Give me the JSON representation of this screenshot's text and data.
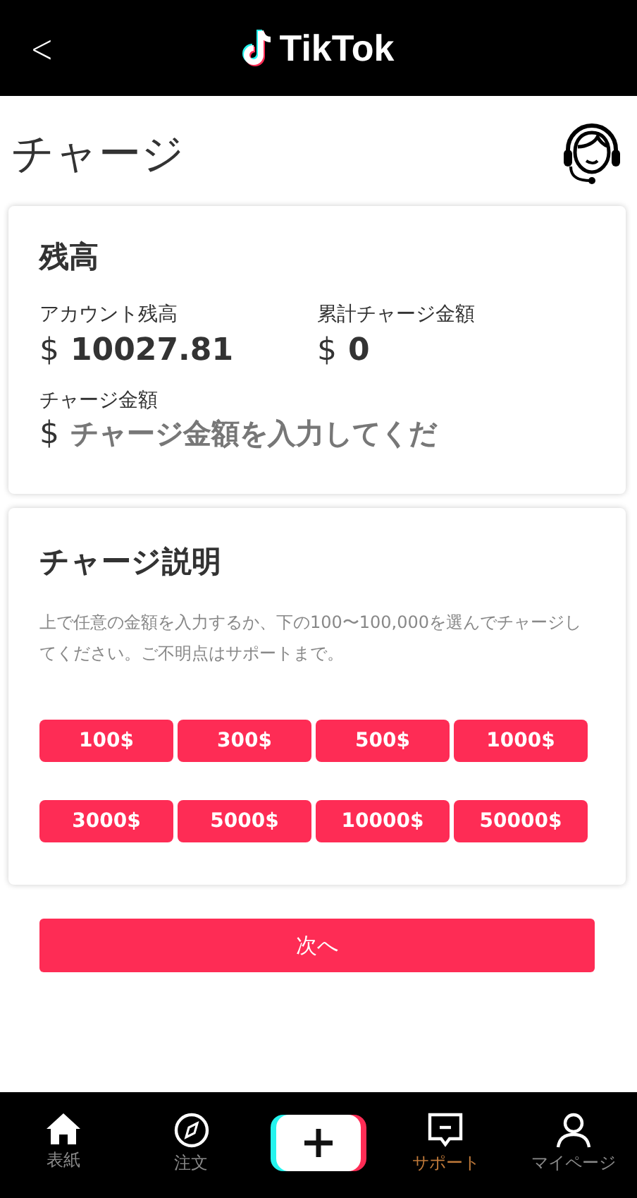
{
  "header": {
    "back": "<",
    "logo_text": "TikTok"
  },
  "page_title": "チャージ",
  "balance_card": {
    "title": "残高",
    "stats": [
      {
        "label": "アカウント残高",
        "currency": "$",
        "value": "10027.81"
      },
      {
        "label": "累計チャージ金額",
        "currency": "$",
        "value": "0"
      }
    ],
    "amount_label": "チャージ金額",
    "amount_currency": "$",
    "amount_placeholder": "チャージ金額を入力してくだ"
  },
  "info_card": {
    "title": "チャージ説明",
    "description": "上で任意の金額を入力するか、下の100〜100,000を選んでチャージしてください。ご不明点はサポートまで。",
    "amounts": [
      "100$",
      "300$",
      "500$",
      "1000$",
      "3000$",
      "5000$",
      "10000$",
      "50000$"
    ]
  },
  "next_button": "次へ",
  "nav": [
    {
      "kind": "home",
      "label": "表紙",
      "selected": false
    },
    {
      "kind": "compass",
      "label": "注文",
      "selected": false
    },
    {
      "kind": "plus"
    },
    {
      "kind": "message",
      "label": "サポート",
      "selected": true
    },
    {
      "kind": "user",
      "label": "マイページ",
      "selected": false
    }
  ]
}
